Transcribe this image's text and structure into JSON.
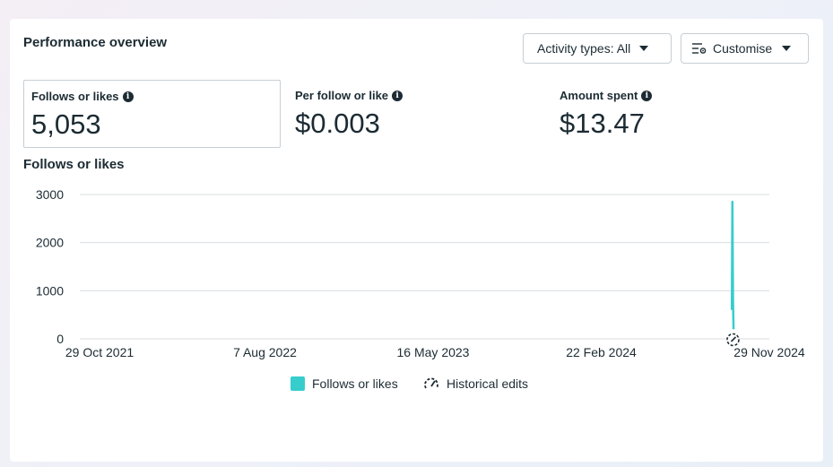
{
  "card": {
    "title": "Performance overview",
    "activity_button": "Activity types: All",
    "customise_button": "Customise"
  },
  "metrics": [
    {
      "label": "Follows or likes",
      "value": "5,053",
      "selected": true
    },
    {
      "label": "Per follow or like",
      "value": "$0.003",
      "selected": false
    },
    {
      "label": "Amount spent",
      "value": "$13.47",
      "selected": false
    }
  ],
  "colors": {
    "series": "#37cdcd",
    "grid": "#dadde1",
    "text": "#1c2b33"
  },
  "chart_data": {
    "type": "line",
    "title": "Follows or likes",
    "xlabel": "",
    "ylabel": "",
    "x_tick_labels": [
      "29 Oct 2021",
      "7 Aug 2022",
      "16 May 2023",
      "22 Feb 2024",
      "29 Nov 2024"
    ],
    "y_ticks": [
      0,
      1000,
      2000,
      3000
    ],
    "ylim": [
      0,
      3000
    ],
    "xlim": [
      "2021-10-29",
      "2024-11-29"
    ],
    "grid": true,
    "legend_position": "bottom",
    "series": [
      {
        "name": "Follows or likes",
        "color": "#37cdcd",
        "points": [
          {
            "x": "2024-11-23",
            "y": 600
          },
          {
            "x": "2024-11-24",
            "y": 2850
          },
          {
            "x": "2024-11-25",
            "y": 800
          },
          {
            "x": "2024-11-26",
            "y": 200
          }
        ]
      }
    ],
    "annotations": [
      {
        "type": "historical-edit",
        "x": "2024-11-25"
      }
    ],
    "legend": [
      "Follows or likes",
      "Historical edits"
    ]
  }
}
